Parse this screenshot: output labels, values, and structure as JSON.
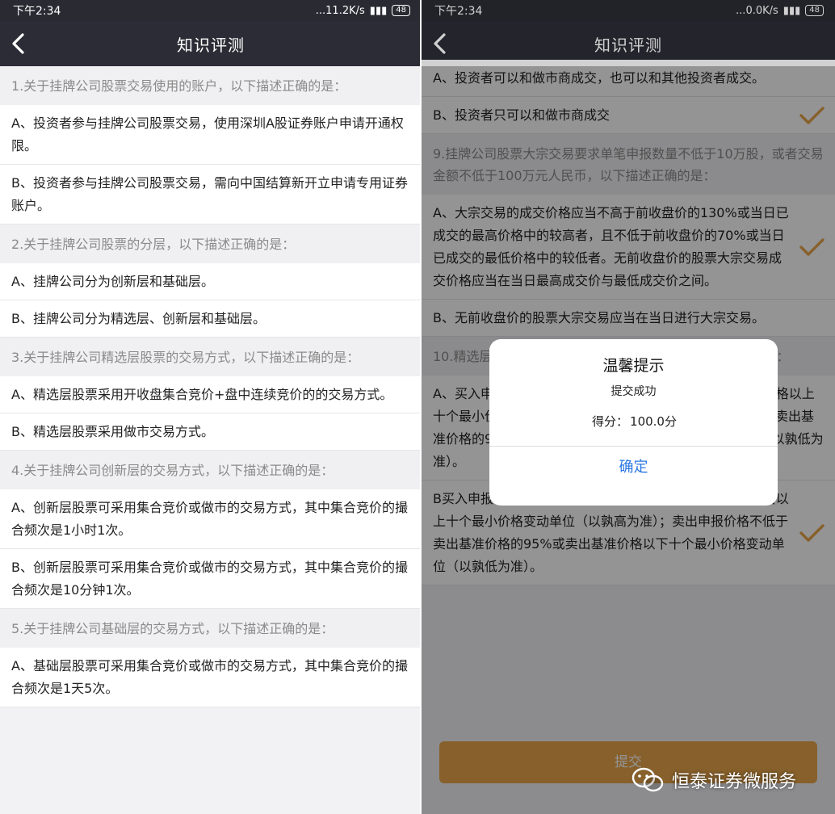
{
  "colors": {
    "accent": "#e8a54b",
    "navbar": "#2c2c36",
    "dialog_button": "#2b78e4"
  },
  "left": {
    "status": {
      "time": "下午2:34",
      "net": "...11.2K/s",
      "battery": "48"
    },
    "nav": {
      "title": "知识评测",
      "back_icon": "chevron-left-icon"
    },
    "items": [
      {
        "type": "q",
        "text": "1.关于挂牌公司股票交易使用的账户，以下描述正确的是："
      },
      {
        "type": "opt",
        "text": "A、投资者参与挂牌公司股票交易，使用深圳A股证券账户申请开通权限。"
      },
      {
        "type": "opt",
        "text": "B、投资者参与挂牌公司股票交易，需向中国结算新开立申请专用证券账户。"
      },
      {
        "type": "q",
        "text": "2.关于挂牌公司股票的分层，以下描述正确的是："
      },
      {
        "type": "opt",
        "text": "A、挂牌公司分为创新层和基础层。"
      },
      {
        "type": "opt",
        "text": "B、挂牌公司分为精选层、创新层和基础层。"
      },
      {
        "type": "q",
        "text": "3.关于挂牌公司精选层股票的交易方式，以下描述正确的是："
      },
      {
        "type": "opt",
        "text": "A、精选层股票采用开收盘集合竞价+盘中连续竞价的的交易方式。"
      },
      {
        "type": "opt",
        "text": "B、精选层股票采用做市交易方式。"
      },
      {
        "type": "q",
        "text": "4.关于挂牌公司创新层的交易方式，以下描述正确的是："
      },
      {
        "type": "opt",
        "text": "A、创新层股票可采用集合竞价或做市的交易方式，其中集合竞价的撮合频次是1小时1次。"
      },
      {
        "type": "opt",
        "text": "B、创新层股票可采用集合竞价或做市的交易方式，其中集合竞价的撮合频次是10分钟1次。"
      },
      {
        "type": "q",
        "text": "5.关于挂牌公司基础层的交易方式，以下描述正确的是："
      },
      {
        "type": "opt",
        "text": "A、基础层股票可采用集合竞价或做市的交易方式，其中集合竞价的撮合频次是1天5次。"
      }
    ]
  },
  "right": {
    "status": {
      "time": "下午2:34",
      "net": "...0.0K/s",
      "battery": "48"
    },
    "nav": {
      "title": "知识评测",
      "back_icon": "chevron-left-icon"
    },
    "items": [
      {
        "type": "opt",
        "text": "A、投资者可以和做市商成交，也可以和其他投资者成交。",
        "selected": false
      },
      {
        "type": "opt",
        "text": "B、投资者只可以和做市商成交",
        "selected": true
      },
      {
        "type": "q",
        "text": "9.挂牌公司股票大宗交易要求单笔申报数量不低于10万股，或者交易金额不低于100万元人民币，以下描述正确的是："
      },
      {
        "type": "opt",
        "text": "A、大宗交易的成交价格应当不高于前收盘价的130%或当日已成交的最高价格中的较高者，且不低于前收盘价的70%或当日已成交的最低价格中的较低者。无前收盘价的股票大宗交易成交价格应当在当日最高成交价与最低成交价之间。",
        "selected": true
      },
      {
        "type": "opt",
        "text": "B、无前收盘价的股票大宗交易应当在当日进行大宗交易。",
        "selected": false
      },
      {
        "type": "q",
        "text": "10.精选层股票连续竞价阶段的申报价格，以下描述正确的是："
      },
      {
        "type": "opt",
        "text": "A、买入申报价格不高于买入基准价格的110%或买入基准价格以上十个最小价格变动单位（以孰高为准）；卖出申报价格不低于卖出基准价格的90%或卖出基准价格以下十个最小价格变动单位（以孰低为准）。",
        "selected": false
      },
      {
        "type": "opt",
        "text": "B买入申报价格不高于买入基准价格的105%或买入基准价格以上十个最小价格变动单位（以孰高为准）；卖出申报价格不低于卖出基准价格的95%或卖出基准价格以下十个最小价格变动单位（以孰低为准）。",
        "selected": true
      }
    ],
    "submit_label": "提交",
    "dialog": {
      "title": "温馨提示",
      "message": "提交成功",
      "score_label": "得分：",
      "score_value": "100.0分",
      "button": "确定"
    },
    "watermark": "恒泰证券微服务"
  }
}
